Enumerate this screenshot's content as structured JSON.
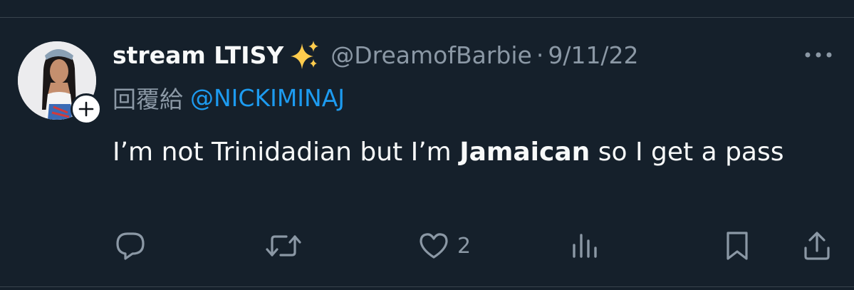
{
  "tweet": {
    "display_name": "stream LTISY",
    "emoji": "✨",
    "handle": "@DreamofBarbie",
    "separator": "·",
    "date": "9/11/22",
    "reply_prefix": "回覆給",
    "reply_to": "@NICKIMINAJ",
    "text_part1": "I’m not Trinidadian but I’m ",
    "text_bold": "Jamaican",
    "text_part2": " so I get a pass"
  },
  "actions": {
    "reply_icon": "reply-icon",
    "retweet_icon": "retweet-icon",
    "like_icon": "like-icon",
    "like_count": "2",
    "views_icon": "views-icon",
    "bookmark_icon": "bookmark-icon",
    "share_icon": "share-icon"
  },
  "colors": {
    "background": "#15202b",
    "primary_text": "#f7f9f9",
    "secondary_text": "#8b98a5",
    "link": "#1d9bf0"
  }
}
